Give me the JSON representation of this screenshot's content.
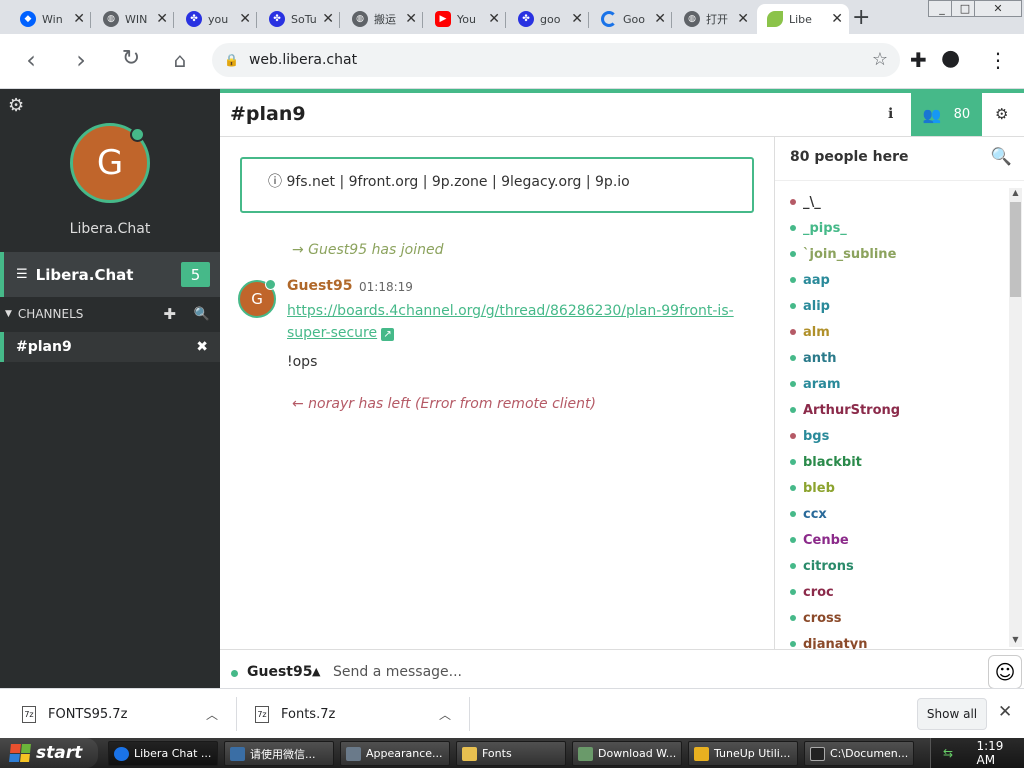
{
  "browser": {
    "tabs": [
      {
        "title": "Win",
        "icon": "dropbox-icon",
        "color": "#0061ff"
      },
      {
        "title": "WIN",
        "icon": "globe-icon",
        "color": "#5f6368"
      },
      {
        "title": "you",
        "icon": "baidu-paw-icon",
        "color": "#2932e1"
      },
      {
        "title": "SoTu",
        "icon": "baidu-paw-icon",
        "color": "#2932e1"
      },
      {
        "title": "搬运",
        "icon": "globe-icon",
        "color": "#5f6368"
      },
      {
        "title": "You",
        "icon": "youtube-icon",
        "color": "#ff0000"
      },
      {
        "title": "goo",
        "icon": "baidu-paw-icon",
        "color": "#2932e1"
      },
      {
        "title": "Goo",
        "icon": "loading-spinner-icon",
        "color": "#1a73e8"
      },
      {
        "title": "打开",
        "icon": "globe-icon",
        "color": "#5f6368"
      },
      {
        "title": "Libe",
        "icon": "libera-leaf-icon",
        "color": "#8bc34a",
        "active": true
      }
    ],
    "new_tab": "+",
    "window_buttons": [
      "_",
      "□",
      "✕"
    ],
    "url": "web.libera.chat"
  },
  "sidebar": {
    "avatar_letter": "G",
    "network_label": "Libera.Chat",
    "network_name": "Libera.Chat",
    "network_badge": "5",
    "channels_header": "CHANNELS",
    "channel": "#plan9"
  },
  "channel": {
    "title": "#plan9",
    "user_count": "80",
    "topic": "9fs.net | 9front.org | 9p.zone | 9legacy.org | 9p.io"
  },
  "messages": {
    "join_text": "→ Guest95 has joined",
    "join_nick": "Guest95",
    "avatar_letter": "G",
    "nick": "Guest95",
    "time": "01:18:19",
    "link": "https://boards.4channel.org/g/thread/86286230/plan-99front-is-super-secure",
    "text": "!ops",
    "part_text": "← norayr has left (Error from remote client)"
  },
  "members": {
    "header": "80 people here",
    "list": [
      {
        "nick": "_\\_",
        "color": "#333333",
        "dot": "#b55a66"
      },
      {
        "nick": "_pips_",
        "color": "#46b989",
        "dot": "#46b989"
      },
      {
        "nick": "`join_subline",
        "color": "#8ca35e",
        "dot": "#46b989"
      },
      {
        "nick": "aap",
        "color": "#2a8a9a",
        "dot": "#46b989"
      },
      {
        "nick": "alip",
        "color": "#2a8a9a",
        "dot": "#46b989"
      },
      {
        "nick": "alm",
        "color": "#b0902a",
        "dot": "#b55a66"
      },
      {
        "nick": "anth",
        "color": "#2a7a8a",
        "dot": "#46b989"
      },
      {
        "nick": "aram",
        "color": "#2a8a9a",
        "dot": "#46b989"
      },
      {
        "nick": "ArthurStrong",
        "color": "#8b2a4a",
        "dot": "#46b989"
      },
      {
        "nick": "bgs",
        "color": "#2a8a9a",
        "dot": "#b55a66"
      },
      {
        "nick": "blackbit",
        "color": "#2a8a4a",
        "dot": "#46b989"
      },
      {
        "nick": "bleb",
        "color": "#8ca32e",
        "dot": "#46b989"
      },
      {
        "nick": "ccx",
        "color": "#2a6a9a",
        "dot": "#46b989"
      },
      {
        "nick": "Cenbe",
        "color": "#8b2a8a",
        "dot": "#46b989"
      },
      {
        "nick": "citrons",
        "color": "#2a8a6a",
        "dot": "#46b989"
      },
      {
        "nick": "croc",
        "color": "#8b2a4a",
        "dot": "#46b989"
      },
      {
        "nick": "cross",
        "color": "#8b4a2a",
        "dot": "#46b989"
      },
      {
        "nick": "djanatyn",
        "color": "#8b4a2a",
        "dot": "#46b989"
      }
    ]
  },
  "input": {
    "nick": "Guest95",
    "placeholder": "Send a message..."
  },
  "downloads": {
    "items": [
      "FONTS95.7z",
      "Fonts.7z"
    ],
    "show_all": "Show all"
  },
  "taskbar": {
    "start": "start",
    "tasks": [
      {
        "label": "Libera Chat ...",
        "icon": "chrome-icon",
        "color": "#1a73e8"
      },
      {
        "label": "请使用微信...",
        "icon": "window-icon",
        "color": "#3a6ea5"
      },
      {
        "label": "Appearance...",
        "icon": "display-icon",
        "color": "#6a7a8a"
      },
      {
        "label": "Fonts",
        "icon": "folder-icon",
        "color": "#e8c050"
      },
      {
        "label": "Download W...",
        "icon": "download-icon",
        "color": "#6a9a6a"
      },
      {
        "label": "TuneUp Utili...",
        "icon": "tuneup-icon",
        "color": "#e8b020"
      },
      {
        "label": "C:\\Documen...",
        "icon": "cmd-icon",
        "color": "#222222"
      }
    ],
    "clock": "1:19 AM"
  }
}
